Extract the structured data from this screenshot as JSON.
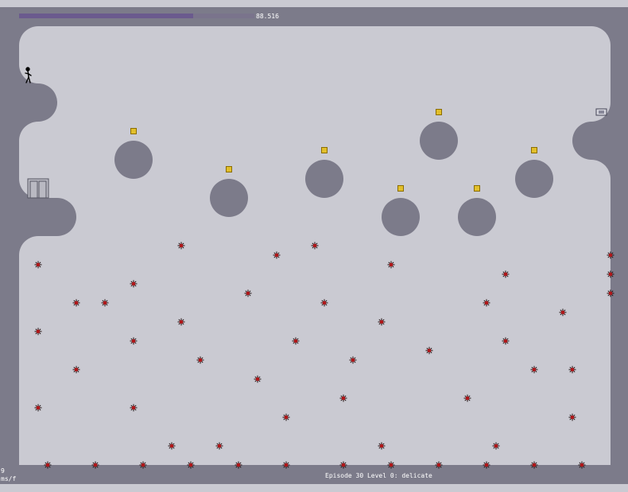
{
  "hud": {
    "time_remaining": "88.516",
    "time_fraction": 0.74,
    "fps_value": "9",
    "fps_unit": "ms/f",
    "episode_label": "Episode 30 Level 0: delicate"
  },
  "colors": {
    "wall": "#7c7b8a",
    "floor": "#cacad2",
    "gold": "#e2bf2b",
    "mine": "#b1171a",
    "ninja": "#000000"
  },
  "entities": {
    "player": "ninja-icon",
    "exit": "exit-door-icon",
    "switch": "exit-switch-icon",
    "gold": "gold-icon",
    "mine": "mine-icon"
  }
}
